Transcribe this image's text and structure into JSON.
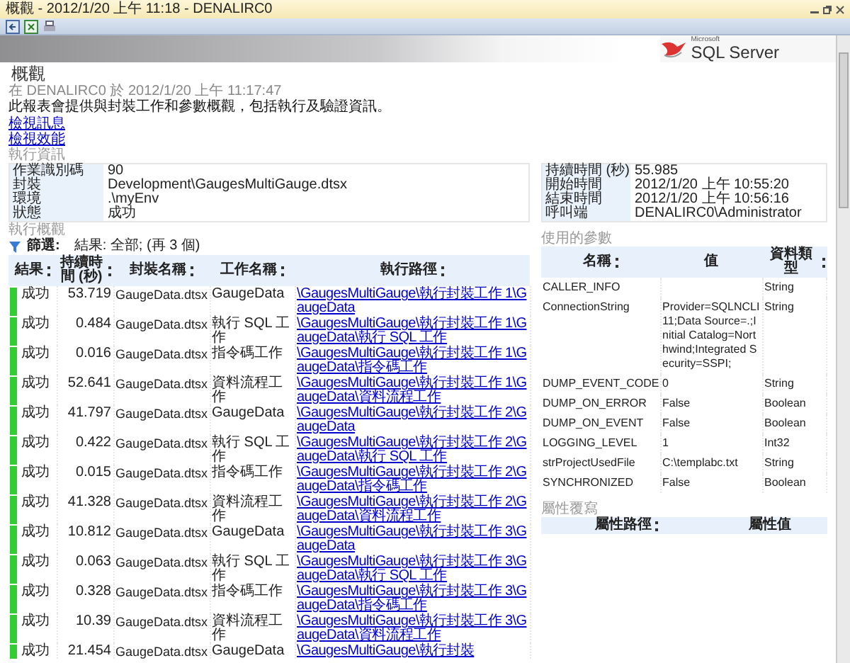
{
  "window": {
    "title": "概觀 - 2012/1/20 上午 11:18 - DENALIRC0"
  },
  "banner": {
    "logo_small": "Microsoft",
    "logo": "SQL Server"
  },
  "report": {
    "title": "概觀",
    "subtitle": "在 DENALIRC0 於 2012/1/20 上午 11:17:47",
    "description": "此報表會提供與封裝工作和參數概觀，包括執行及驗證資訊。",
    "links": [
      "檢視訊息",
      "檢視效能"
    ]
  },
  "execution_info": {
    "title": "執行資訊",
    "left": [
      {
        "label": "作業識別碼",
        "value": "90"
      },
      {
        "label": "封裝",
        "value": "Development\\GaugesMultiGauge.dtsx"
      },
      {
        "label": "環境",
        "value": ".\\myEnv"
      },
      {
        "label": "狀態",
        "value": "成功"
      }
    ],
    "right": [
      {
        "label": "持續時間 (秒)",
        "value": "55.985"
      },
      {
        "label": "開始時間",
        "value": "2012/1/20 上午 10:55:20"
      },
      {
        "label": "結束時間",
        "value": "2012/1/20 上午 10:56:16"
      },
      {
        "label": "呼叫端",
        "value": "DENALIRC0\\Administrator"
      }
    ]
  },
  "execution_overview": {
    "title": "執行概觀",
    "filter": {
      "label": "篩選:",
      "value": "結果: 全部; (再 3 個)"
    },
    "columns": [
      {
        "label": "結果",
        "sortable": true
      },
      {
        "label": "持續時間 (秒)",
        "sortable": true
      },
      {
        "label": "封裝名稱",
        "sortable": true
      },
      {
        "label": "工作名稱",
        "sortable": true
      },
      {
        "label": "執行路徑",
        "sortable": true
      }
    ],
    "rows": [
      {
        "result": "成功",
        "color": "#33cc33",
        "duration": "53.719",
        "package": "GaugeData.dtsx",
        "task": "GaugeData",
        "path": "\\GaugesMultiGauge\\執行封裝工作 1\\GaugeData"
      },
      {
        "result": "成功",
        "color": "#33cc33",
        "duration": "0.484",
        "package": "GaugeData.dtsx",
        "task": "執行 SQL 工作",
        "path": "\\GaugesMultiGauge\\執行封裝工作 1\\GaugeData\\執行 SQL 工作"
      },
      {
        "result": "成功",
        "color": "#33cc33",
        "duration": "0.016",
        "package": "GaugeData.dtsx",
        "task": "指令碼工作",
        "path": "\\GaugesMultiGauge\\執行封裝工作 1\\GaugeData\\指令碼工作"
      },
      {
        "result": "成功",
        "color": "#33cc33",
        "duration": "52.641",
        "package": "GaugeData.dtsx",
        "task": "資料流程工作",
        "path": "\\GaugesMultiGauge\\執行封裝工作 1\\GaugeData\\資料流程工作"
      },
      {
        "result": "成功",
        "color": "#33cc33",
        "duration": "41.797",
        "package": "GaugeData.dtsx",
        "task": "GaugeData",
        "path": "\\GaugesMultiGauge\\執行封裝工作 2\\GaugeData"
      },
      {
        "result": "成功",
        "color": "#33cc33",
        "duration": "0.422",
        "package": "GaugeData.dtsx",
        "task": "執行 SQL 工作",
        "path": "\\GaugesMultiGauge\\執行封裝工作 2\\GaugeData\\執行 SQL 工作"
      },
      {
        "result": "成功",
        "color": "#33cc33",
        "duration": "0.015",
        "package": "GaugeData.dtsx",
        "task": "指令碼工作",
        "path": "\\GaugesMultiGauge\\執行封裝工作 2\\GaugeData\\指令碼工作"
      },
      {
        "result": "成功",
        "color": "#33cc33",
        "duration": "41.328",
        "package": "GaugeData.dtsx",
        "task": "資料流程工作",
        "path": "\\GaugesMultiGauge\\執行封裝工作 2\\GaugeData\\資料流程工作"
      },
      {
        "result": "成功",
        "color": "#33cc33",
        "duration": "10.812",
        "package": "GaugeData.dtsx",
        "task": "GaugeData",
        "path": "\\GaugesMultiGauge\\執行封裝工作 3\\GaugeData"
      },
      {
        "result": "成功",
        "color": "#33cc33",
        "duration": "0.063",
        "package": "GaugeData.dtsx",
        "task": "執行 SQL 工作",
        "path": "\\GaugesMultiGauge\\執行封裝工作 3\\GaugeData\\執行 SQL 工作"
      },
      {
        "result": "成功",
        "color": "#33cc33",
        "duration": "0.328",
        "package": "GaugeData.dtsx",
        "task": "指令碼工作",
        "path": "\\GaugesMultiGauge\\執行封裝工作 3\\GaugeData\\指令碼工作"
      },
      {
        "result": "成功",
        "color": "#33cc33",
        "duration": "10.39",
        "package": "GaugeData.dtsx",
        "task": "資料流程工作",
        "path": "\\GaugesMultiGauge\\執行封裝工作 3\\GaugeData\\資料流程工作"
      },
      {
        "result": "成功",
        "color": "#33cc33",
        "duration": "21.454",
        "package": "GaugeData.dtsx",
        "task": "GaugeData",
        "path": "\\GaugesMultiGauge\\執行封裝"
      }
    ]
  },
  "parameters": {
    "title": "使用的參數",
    "columns": [
      {
        "label": "名稱",
        "sortable": true
      },
      {
        "label": "值",
        "sortable": false
      },
      {
        "label": "資料類型",
        "sortable": true
      }
    ],
    "rows": [
      {
        "name": "CALLER_INFO",
        "type": "String"
      },
      {
        "name": "ConnectionString",
        "value": "Provider=SQLNCLI11;Data Source=.;Initial Catalog=Northwind;Integrated Security=SSPI;",
        "type": "String"
      },
      {
        "name": "DUMP_EVENT_CODE",
        "value": "0",
        "type": "String"
      },
      {
        "name": "DUMP_ON_ERROR",
        "value": "False",
        "type": "Boolean"
      },
      {
        "name": "DUMP_ON_EVENT",
        "value": "False",
        "type": "Boolean"
      },
      {
        "name": "LOGGING_LEVEL",
        "value": "1",
        "type": "Int32"
      },
      {
        "name": "strProjectUsedFile",
        "value": "C:\\templabc.txt",
        "type": "String"
      },
      {
        "name": "SYNCHRONIZED",
        "value": "False",
        "type": "Boolean"
      }
    ]
  },
  "property_overrides": {
    "title": "屬性覆寫",
    "columns": [
      {
        "label": "屬性路徑",
        "sortable": true
      },
      {
        "label": "屬性值",
        "sortable": false
      }
    ]
  }
}
